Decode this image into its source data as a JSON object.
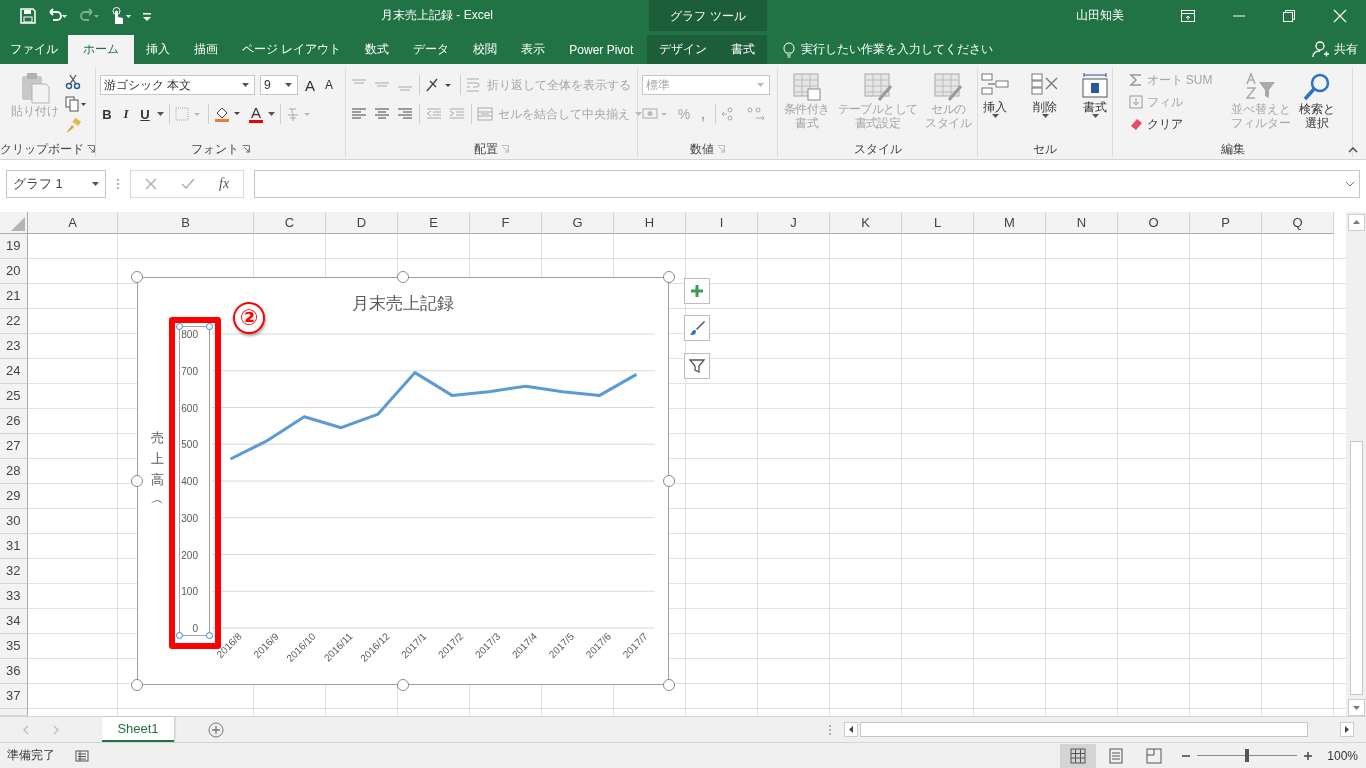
{
  "window": {
    "title": "月末売上記録  -  Excel",
    "context_label": "グラフ ツール",
    "user": "山田知美"
  },
  "tabs": [
    {
      "label": "ファイル",
      "selected": false,
      "kind": "normal"
    },
    {
      "label": "ホーム",
      "selected": true,
      "kind": "normal"
    },
    {
      "label": "挿入",
      "selected": false,
      "kind": "normal"
    },
    {
      "label": "描画",
      "selected": false,
      "kind": "normal"
    },
    {
      "label": "ページ レイアウト",
      "selected": false,
      "kind": "normal"
    },
    {
      "label": "数式",
      "selected": false,
      "kind": "normal"
    },
    {
      "label": "データ",
      "selected": false,
      "kind": "normal"
    },
    {
      "label": "校閲",
      "selected": false,
      "kind": "normal"
    },
    {
      "label": "表示",
      "selected": false,
      "kind": "normal"
    },
    {
      "label": "Power Pivot",
      "selected": false,
      "kind": "normal"
    },
    {
      "label": "デザイン",
      "selected": false,
      "kind": "contextual"
    },
    {
      "label": "書式",
      "selected": false,
      "kind": "contextual"
    }
  ],
  "tell_me": {
    "placeholder": "実行したい作業を入力してください"
  },
  "share": "共有",
  "ribbon": {
    "clipboard": {
      "label": "クリップボード",
      "paste": {
        "label": "貼り付け",
        "disabled": true
      }
    },
    "font": {
      "label": "フォント",
      "font_name": "游ゴシック 本文",
      "font_size": "9",
      "grow": "A",
      "shrink": "A",
      "bold": "B",
      "italic": "I",
      "underline": "U",
      "font_color": "A"
    },
    "alignment": {
      "label": "配置",
      "wrap": {
        "label": "折り返して全体を表示する",
        "disabled": true
      },
      "merge": {
        "label": "セルを結合して中央揃え",
        "disabled": true
      }
    },
    "number": {
      "label": "数値",
      "format": {
        "value": "標準",
        "disabled": true
      },
      "percent": "%",
      "comma": ","
    },
    "styles": {
      "label": "スタイル",
      "buttons": [
        {
          "lines": [
            "条件付き",
            "書式"
          ],
          "disabled": true,
          "kind": "conditional"
        },
        {
          "lines": [
            "テーブルとして",
            "書式設定"
          ],
          "disabled": true,
          "kind": "table"
        },
        {
          "lines": [
            "セルの",
            "スタイル"
          ],
          "disabled": true,
          "kind": "cellstyle"
        }
      ]
    },
    "cells": {
      "label": "セル",
      "buttons": [
        {
          "label": "挿入",
          "kind": "insert"
        },
        {
          "label": "削除",
          "kind": "delete"
        },
        {
          "label": "書式",
          "kind": "format"
        }
      ]
    },
    "editing": {
      "label": "編集",
      "autosum": {
        "label": "オート SUM",
        "disabled": true
      },
      "fill": {
        "label": "フィル",
        "disabled": true
      },
      "clear": {
        "label": "クリア",
        "disabled": false
      },
      "sort": {
        "lines": [
          "並べ替えと",
          "フィルター"
        ],
        "disabled": true
      },
      "find": {
        "lines": [
          "検索と",
          "選択"
        ],
        "disabled": false
      }
    }
  },
  "formula_bar": {
    "name_box": "グラフ 1",
    "fx": "fx"
  },
  "sheet": {
    "columns": [
      "A",
      "B",
      "C",
      "D",
      "E",
      "F",
      "G",
      "H",
      "I",
      "J",
      "K",
      "L",
      "M",
      "N",
      "O",
      "P",
      "Q"
    ],
    "rows": [
      "19",
      "20",
      "21",
      "22",
      "23",
      "24",
      "25",
      "26",
      "27",
      "28",
      "29",
      "30",
      "31",
      "32",
      "33",
      "34",
      "35",
      "36",
      "37"
    ]
  },
  "chart": {
    "chart_data": {
      "type": "line",
      "title": "月末売上記録",
      "ylabel": "売上高︵",
      "categories": [
        "2016/8",
        "2016/9",
        "2016/10",
        "2016/11",
        "2016/12",
        "2017/1",
        "2017/2",
        "2017/3",
        "2017/4",
        "2017/5",
        "2017/6",
        "2017/7"
      ],
      "series": [
        {
          "color": "#5b9bd5",
          "values": [
            460,
            510,
            575,
            545,
            582,
            695,
            633,
            643,
            658,
            643,
            633,
            690
          ]
        }
      ],
      "ylim": [
        0,
        800
      ],
      "yticks": [
        0,
        100,
        200,
        300,
        400,
        500,
        600,
        700,
        800
      ],
      "grid": true
    },
    "annotation": "②"
  },
  "sheet_tabs": [
    {
      "label": "Sheet1",
      "selected": true
    }
  ],
  "status_bar": {
    "status": "準備完了",
    "zoom": {
      "level": 0.5,
      "reading": "100%"
    }
  }
}
